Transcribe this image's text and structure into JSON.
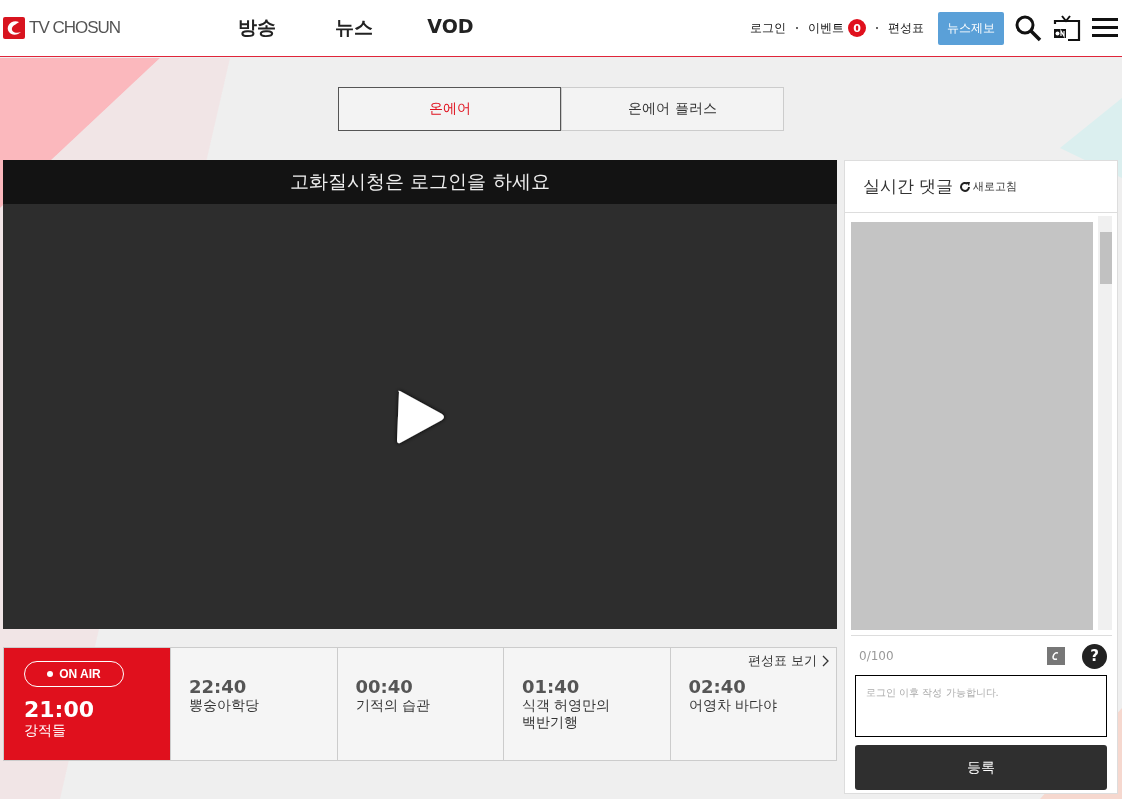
{
  "header": {
    "logo": "TV CHOSUN",
    "nav": [
      "방송",
      "뉴스",
      "VOD"
    ],
    "links": [
      {
        "label": "로그인"
      },
      {
        "label": "이벤트",
        "badge": "0"
      },
      {
        "label": "편성표"
      }
    ],
    "report_button": "뉴스제보"
  },
  "tabs": [
    {
      "label": "온에어",
      "selected": true
    },
    {
      "label": "온에어 플러스",
      "selected": false
    }
  ],
  "player": {
    "notice": "고화질시청은 로그인을 하세요"
  },
  "schedule": {
    "more_link": "편성표 보기",
    "items": [
      {
        "time": "21:00",
        "title": "강적들",
        "on_air": true,
        "badge": "ON AIR"
      },
      {
        "time": "22:40",
        "title": "뽕숭아학당",
        "on_air": false
      },
      {
        "time": "00:40",
        "title": "기적의 습관",
        "on_air": false
      },
      {
        "time": "01:40",
        "title": "식객 허영만의\n백반기행",
        "on_air": false
      },
      {
        "time": "02:40",
        "title": "어영차 바다야",
        "on_air": false
      }
    ]
  },
  "chat": {
    "title": "실시간 댓글",
    "refresh": "새로고침",
    "counter": "0/100",
    "placeholder": "로그인 이후 작성 가능합니다.",
    "submit": "등록",
    "help": "?"
  }
}
